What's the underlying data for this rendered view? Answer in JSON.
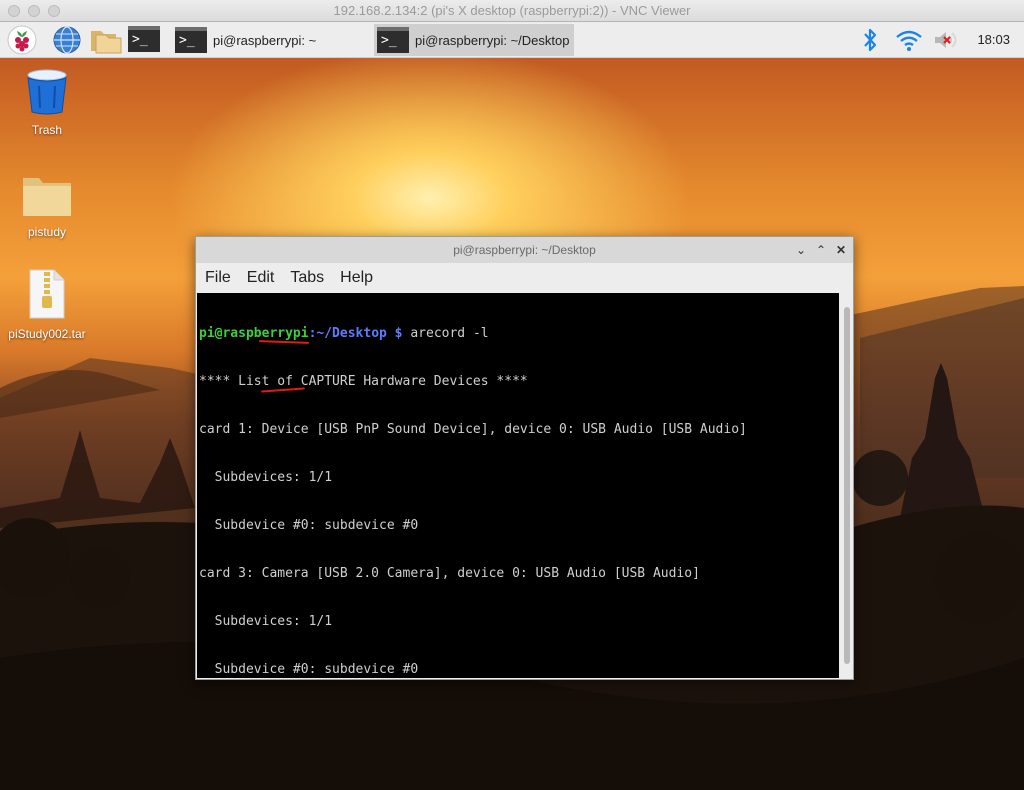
{
  "window_title": "192.168.2.134:2 (pi's X desktop (raspberrypi:2)) - VNC Viewer",
  "panel": {
    "task1": "pi@raspberrypi: ~",
    "task2": "pi@raspberrypi: ~/Desktop",
    "terminal_glyph": ">_",
    "clock": "18:03"
  },
  "desktop_icons": {
    "trash": "Trash",
    "folder": "pistudy",
    "archive": "piStudy002.tar"
  },
  "terminal": {
    "title": "pi@raspberrypi: ~/Desktop",
    "menu": [
      "File",
      "Edit",
      "Tabs",
      "Help"
    ],
    "prompt_user": "pi@raspberrypi",
    "prompt_path": ":~/Desktop",
    "prompt_dollar": " $ ",
    "command": "arecord -l",
    "lines": [
      "**** List of CAPTURE Hardware Devices ****",
      "card 1: Device [USB PnP Sound Device], device 0: USB Audio [USB Audio]",
      "  Subdevices: 1/1",
      "  Subdevice #0: subdevice #0",
      "card 3: Camera [USB 2.0 Camera], device 0: USB Audio [USB Audio]",
      "  Subdevices: 1/1",
      "  Subdevice #0: subdevice #0"
    ]
  },
  "colors": {
    "prompt_user": "#39d03c",
    "prompt_path": "#5d7bff",
    "annotation": "#e21a1a"
  }
}
